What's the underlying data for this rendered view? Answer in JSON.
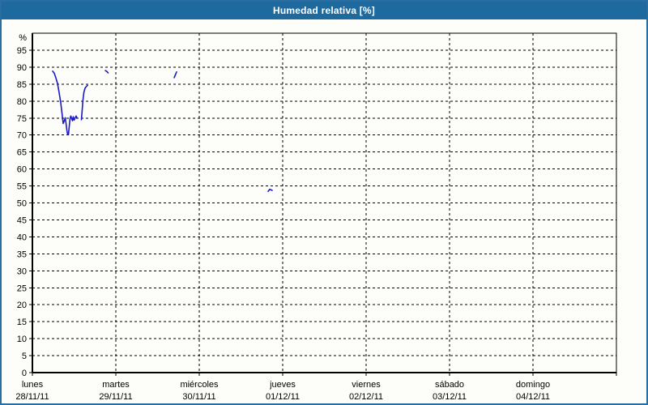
{
  "title": "Humedad relativa [%]",
  "colors": {
    "title_bar": "#1e6a9e",
    "window_border": "#2a6da0",
    "background": "#fdfdfa",
    "grid": "#000000",
    "axis": "#000000",
    "series": "#1a1ac8",
    "title_text": "#ffffff",
    "label_text": "#000000"
  },
  "chart_data": {
    "type": "line",
    "title": "Humedad relativa [%]",
    "y_unit_label": "%",
    "ylim": [
      0,
      100
    ],
    "y_tick_step": 5,
    "y_tick_labels": [
      "0",
      "5",
      "10",
      "15",
      "20",
      "25",
      "30",
      "35",
      "40",
      "45",
      "50",
      "55",
      "60",
      "65",
      "70",
      "75",
      "80",
      "85",
      "90",
      "95"
    ],
    "grid": "dashed",
    "legend": "none",
    "x_categories": [
      {
        "day": "lunes",
        "date": "28/11/11"
      },
      {
        "day": "martes",
        "date": "29/11/11"
      },
      {
        "day": "miércoles",
        "date": "30/11/11"
      },
      {
        "day": "jueves",
        "date": "01/12/11"
      },
      {
        "day": "viernes",
        "date": "02/12/11"
      },
      {
        "day": "sábado",
        "date": "03/12/11"
      },
      {
        "day": "domingo",
        "date": "04/12/11"
      }
    ],
    "series": [
      {
        "name": "Humedad relativa",
        "color": "#1a1ac8",
        "x_unit": "days-from-start (0 = lunes 00:00)",
        "segments": [
          [
            [
              0.243,
              88.8
            ],
            [
              0.262,
              88.2
            ],
            [
              0.282,
              86.8
            ],
            [
              0.301,
              85.2
            ],
            [
              0.32,
              82.5
            ],
            [
              0.34,
              79.5
            ],
            [
              0.354,
              76.5
            ],
            [
              0.369,
              73.4
            ],
            [
              0.383,
              74.2
            ],
            [
              0.393,
              75.1
            ],
            [
              0.403,
              73.5
            ],
            [
              0.413,
              71.5
            ],
            [
              0.422,
              70.2
            ],
            [
              0.432,
              70.1
            ],
            [
              0.442,
              72.6
            ],
            [
              0.451,
              74.9
            ],
            [
              0.461,
              75.6
            ],
            [
              0.471,
              74.8
            ],
            [
              0.481,
              74.2
            ],
            [
              0.49,
              75.4
            ],
            [
              0.5,
              74.4
            ],
            [
              0.51,
              74.9
            ],
            [
              0.524,
              75.6
            ],
            [
              0.534,
              75.1
            ]
          ],
          [
            [
              0.587,
              74.5
            ],
            [
              0.597,
              77.5
            ],
            [
              0.607,
              80.5
            ],
            [
              0.617,
              82.6
            ],
            [
              0.631,
              83.8
            ],
            [
              0.646,
              84.3
            ],
            [
              0.66,
              84.6
            ]
          ],
          [
            [
              0.874,
              89.0
            ],
            [
              0.893,
              88.7
            ],
            [
              0.908,
              88.3
            ]
          ],
          [
            [
              1.699,
              86.9
            ],
            [
              1.714,
              87.7
            ],
            [
              1.728,
              88.6
            ]
          ],
          [
            [
              2.825,
              53.4
            ],
            [
              2.845,
              54.0
            ],
            [
              2.874,
              53.7
            ]
          ]
        ]
      }
    ]
  }
}
